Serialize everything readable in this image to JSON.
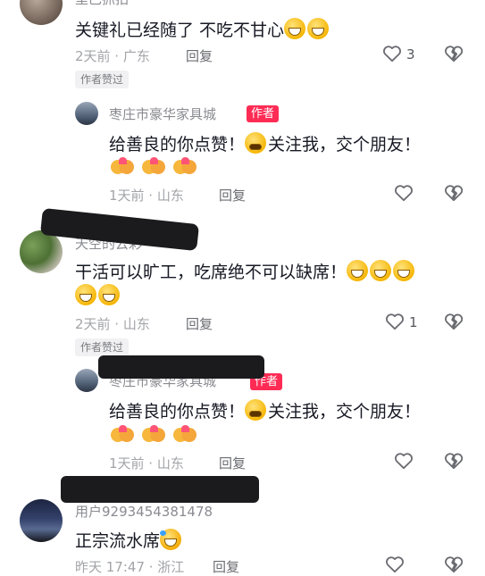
{
  "comments": [
    {
      "username": "里巴抓拍",
      "text": "关键礼已经随了 不吃不甘心",
      "time_location": "2天前 · 广东",
      "reply_label": "回复",
      "like_count": "3",
      "author_liked": "作者赞过",
      "reply": {
        "username": "枣庄市豪华家具城",
        "badge": "作者",
        "text": "给善良的你点赞！",
        "text2": "关注我，交个朋友！",
        "time_location": "1天前 · 山东",
        "reply_label": "回复"
      }
    },
    {
      "username": "天空的云彩",
      "text_line1": "干活可以旷工，吃席绝不可以缺席！",
      "time_location": "2天前 · 山东",
      "reply_label": "回复",
      "like_count": "1",
      "author_liked": "作者赞过",
      "reply": {
        "username": "枣庄市豪华家具城",
        "badge": "作者",
        "text": "给善良的你点赞！",
        "text2": "关注我，交个朋友！",
        "time_location": "1天前 · 山东",
        "reply_label": "回复"
      }
    },
    {
      "username": "用户9293454381478",
      "text": "正宗流水席",
      "time_location": "昨天 17:47 · 浙江",
      "reply_label": "回复"
    }
  ],
  "icons": {
    "like": "heart-outline-icon",
    "dislike": "broken-heart-icon"
  }
}
